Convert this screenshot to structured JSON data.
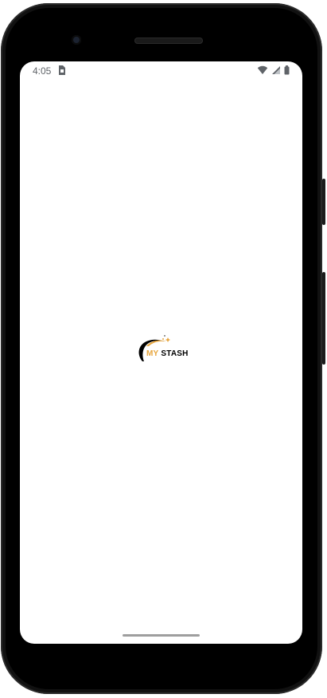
{
  "status_bar": {
    "time": "4:05",
    "icons": [
      "sim-card-icon",
      "wifi-icon",
      "cellular-signal-icon",
      "battery-icon"
    ]
  },
  "splash": {
    "logo_text_my": "MY",
    "logo_text_stash": "STASH",
    "brand_colors": {
      "gold": "#e7a53c",
      "black": "#000000"
    }
  }
}
